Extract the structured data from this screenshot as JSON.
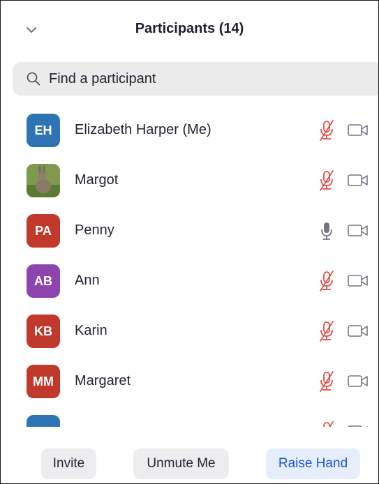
{
  "header": {
    "title": "Participants (14)"
  },
  "search": {
    "placeholder": "Find a participant"
  },
  "colors": {
    "muted_mic": "#e2504b",
    "unmuted_mic": "#747487",
    "camera": "#747487",
    "accent": "#1a56d6"
  },
  "participants": [
    {
      "initials": "EH",
      "name": "Elizabeth Harper (Me)",
      "avatar_color": "#2e74b5",
      "avatar_type": "initials",
      "mic": "muted",
      "camera": "off"
    },
    {
      "initials": "",
      "name": "Margot",
      "avatar_color": "#6c8a3f",
      "avatar_type": "photo",
      "mic": "muted",
      "camera": "off"
    },
    {
      "initials": "PA",
      "name": "Penny",
      "avatar_color": "#c0392b",
      "avatar_type": "initials",
      "mic": "unmuted",
      "camera": "off"
    },
    {
      "initials": "AB",
      "name": "Ann",
      "avatar_color": "#8e44ad",
      "avatar_type": "initials",
      "mic": "muted",
      "camera": "off"
    },
    {
      "initials": "KB",
      "name": "Karin",
      "avatar_color": "#c0392b",
      "avatar_type": "initials",
      "mic": "muted",
      "camera": "off"
    },
    {
      "initials": "MM",
      "name": "Margaret",
      "avatar_color": "#c0392b",
      "avatar_type": "initials",
      "mic": "muted",
      "camera": "off"
    },
    {
      "initials": "",
      "name": "",
      "avatar_color": "#2e74b5",
      "avatar_type": "initials",
      "mic": "muted",
      "camera": "off"
    }
  ],
  "footer": {
    "invite_label": "Invite",
    "unmute_label": "Unmute Me",
    "raise_hand_label": "Raise Hand"
  }
}
